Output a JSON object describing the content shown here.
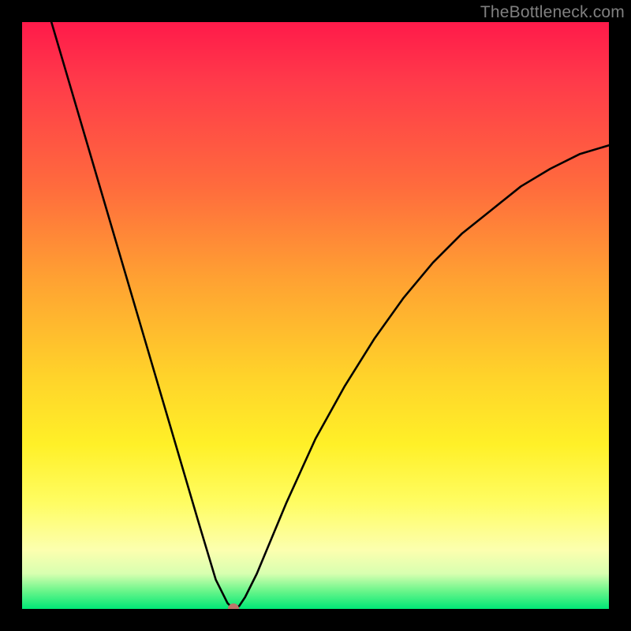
{
  "watermark": "TheBottleneck.com",
  "chart_data": {
    "type": "line",
    "title": "",
    "xlabel": "",
    "ylabel": "",
    "xlim": [
      0,
      100
    ],
    "ylim": [
      0,
      100
    ],
    "series": [
      {
        "name": "bottleneck-curve",
        "x": [
          5,
          10,
          15,
          20,
          25,
          30,
          33,
          35,
          36,
          37,
          38,
          40,
          45,
          50,
          55,
          60,
          65,
          70,
          75,
          80,
          85,
          90,
          95,
          100
        ],
        "y": [
          100,
          83,
          66,
          49,
          32,
          15,
          5,
          1,
          0,
          0.5,
          2,
          6,
          18,
          29,
          38,
          46,
          53,
          59,
          64,
          68,
          72,
          75,
          77.5,
          79
        ]
      }
    ],
    "marker": {
      "x": 36,
      "y": 0
    },
    "background_gradient": {
      "direction": "vertical",
      "stops": [
        {
          "pos": 0.0,
          "color": "#ff1a4a"
        },
        {
          "pos": 0.28,
          "color": "#ff6b3d"
        },
        {
          "pos": 0.6,
          "color": "#ffd22a"
        },
        {
          "pos": 0.82,
          "color": "#fffd63"
        },
        {
          "pos": 0.97,
          "color": "#68f58a"
        },
        {
          "pos": 1.0,
          "color": "#00e876"
        }
      ]
    }
  }
}
